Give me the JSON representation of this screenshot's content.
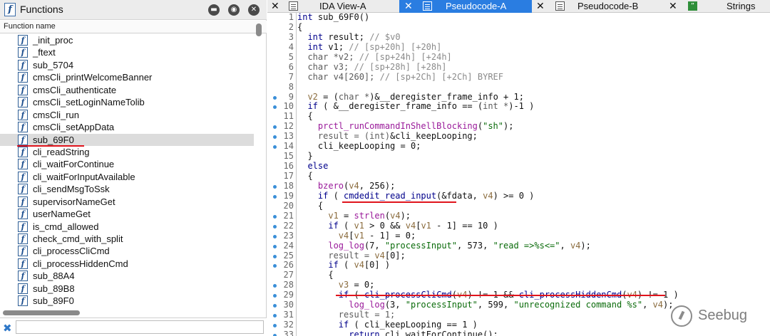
{
  "functions_panel": {
    "title": "Functions",
    "column_header": "Function name",
    "items": [
      "_init_proc",
      "_ftext",
      "sub_5704",
      "cmsCli_printWelcomeBanner",
      "cmsCli_authenticate",
      "cmsCli_setLoginNameTolib",
      "cmsCli_run",
      "cmsCli_setAppData",
      "sub_69F0",
      "cli_readString",
      "cli_waitForContinue",
      "cli_waitForInputAvailable",
      "cli_sendMsgToSsk",
      "supervisorNameGet",
      "userNameGet",
      "is_cmd_allowed",
      "check_cmd_with_split",
      "cli_processCliCmd",
      "cli_processHiddenCmd",
      "sub_88A4",
      "sub_89B8",
      "sub_89F0"
    ],
    "selected_item": "sub_69F0",
    "filter_value": "",
    "function_icon_glyph": "f"
  },
  "tabs": [
    {
      "label": "IDA View-A",
      "icon": "text-view-icon",
      "active": false
    },
    {
      "label": "Pseudocode-A",
      "icon": "text-view-icon",
      "active": true
    },
    {
      "label": "Pseudocode-B",
      "icon": "text-view-icon",
      "active": false
    },
    {
      "label": "Strings",
      "icon": "strings-icon",
      "active": false
    }
  ],
  "code_lines": [
    {
      "num": "1",
      "dot": false,
      "html": "<span class='k'>int</span> <span class='p'>sub_69F0()</span>"
    },
    {
      "num": "2",
      "dot": false,
      "html": "<span class='p'>{</span>"
    },
    {
      "num": "3",
      "dot": false,
      "html": "  <span class='k'>int</span> <span class='p'>result</span><span class='p'>;</span> <span class='c'>// $v0</span>"
    },
    {
      "num": "4",
      "dot": false,
      "html": "  <span class='k'>int</span> <span class='p'>v1</span><span class='p'>;</span> <span class='c'>// [sp+20h] [+20h]</span>"
    },
    {
      "num": "5",
      "dot": false,
      "html": "  <span class='n'>char *v2;</span> <span class='c'>// [sp+24h] [+24h]</span>"
    },
    {
      "num": "6",
      "dot": false,
      "html": "  <span class='n'>char v3;</span> <span class='c'>// [sp+28h] [+28h]</span>"
    },
    {
      "num": "7",
      "dot": false,
      "html": "  <span class='n'>char v4[260];</span> <span class='c'>// [sp+2Ch] [+2Ch] BYREF</span>"
    },
    {
      "num": "8",
      "dot": false,
      "html": ""
    },
    {
      "num": "9",
      "dot": true,
      "html": "  <span class='v'>v2</span> <span class='p'>= (</span><span class='n'>char *</span><span class='p'>)&amp;__deregister_frame_info + 1;</span>"
    },
    {
      "num": "10",
      "dot": true,
      "html": "  <span class='k'>if</span> <span class='p'>( &amp;__deregister_frame_info == (</span><span class='n'>int *</span><span class='p'>)-1 )</span>"
    },
    {
      "num": "11",
      "dot": false,
      "html": "  <span class='p'>{</span>"
    },
    {
      "num": "12",
      "dot": true,
      "html": "    <span class='f'>prctl_runCommandInShellBlocking</span><span class='p'>(</span><span class='s'>\"sh\"</span><span class='p'>);</span>"
    },
    {
      "num": "13",
      "dot": true,
      "html": "    <span class='n'>result = (int)</span><span class='p'>&amp;cli_keepLooping;</span>"
    },
    {
      "num": "14",
      "dot": true,
      "html": "    <span class='p'>cli_keepLooping = 0;</span>"
    },
    {
      "num": "15",
      "dot": false,
      "html": "  <span class='p'>}</span>"
    },
    {
      "num": "16",
      "dot": false,
      "html": "  <span class='k'>else</span>"
    },
    {
      "num": "17",
      "dot": false,
      "html": "  <span class='p'>{</span>"
    },
    {
      "num": "18",
      "dot": true,
      "html": "    <span class='f'>bzero</span><span class='p'>(</span><span class='v'>v4</span><span class='p'>, 256);</span>"
    },
    {
      "num": "19",
      "dot": true,
      "html": "    <span class='k'>if</span> <span class='p'>( </span><span class='k'>cmdedit_read_input</span><span class='p'>(&amp;fdata, </span><span class='v'>v4</span><span class='p'>) &gt;= 0 )</span>"
    },
    {
      "num": "20",
      "dot": false,
      "html": "    <span class='p'>{</span>"
    },
    {
      "num": "21",
      "dot": true,
      "html": "      <span class='v'>v1</span> <span class='p'>=</span> <span class='f'>strlen</span><span class='p'>(</span><span class='v'>v4</span><span class='p'>);</span>"
    },
    {
      "num": "22",
      "dot": true,
      "html": "      <span class='k'>if</span> <span class='p'>( </span><span class='v'>v1</span><span class='p'> &gt; 0 &amp;&amp; </span><span class='v'>v4</span><span class='p'>[</span><span class='v'>v1</span><span class='p'> - 1] == 10 )</span>"
    },
    {
      "num": "23",
      "dot": true,
      "html": "        <span class='v'>v4</span><span class='p'>[</span><span class='v'>v1</span><span class='p'> - 1] = 0;</span>"
    },
    {
      "num": "24",
      "dot": true,
      "html": "      <span class='f'>log_log</span><span class='p'>(7, </span><span class='s'>\"processInput\"</span><span class='p'>, 573, </span><span class='s'>\"read =&gt;%s&lt;=\"</span><span class='p'>, </span><span class='v'>v4</span><span class='p'>);</span>"
    },
    {
      "num": "25",
      "dot": true,
      "html": "      <span class='n'>result = </span><span class='v'>v4</span><span class='p'>[0];</span>"
    },
    {
      "num": "26",
      "dot": true,
      "html": "      <span class='k'>if</span> <span class='p'>( </span><span class='v'>v4</span><span class='p'>[0] )</span>"
    },
    {
      "num": "27",
      "dot": false,
      "html": "      <span class='p'>{</span>"
    },
    {
      "num": "28",
      "dot": true,
      "html": "        <span class='v'>v3</span> <span class='p'>= 0;</span>"
    },
    {
      "num": "29",
      "dot": true,
      "html": "        <span class='k'>if</span> <span class='p'>( </span><span class='k'>cli_processCliCmd</span><span class='p'>(</span><span class='v'>v4</span><span class='p'>) != 1 &amp;&amp; </span><span class='k'>cli_processHiddenCmd</span><span class='p'>(</span><span class='v'>v4</span><span class='p'>) != 1 )</span>"
    },
    {
      "num": "30",
      "dot": true,
      "html": "          <span class='f'>log_log</span><span class='p'>(3, </span><span class='s'>\"processInput\"</span><span class='p'>, 599, </span><span class='s'>\"unrecognized command %s\"</span><span class='p'>, </span><span class='v'>v4</span><span class='p'>);</span>"
    },
    {
      "num": "31",
      "dot": true,
      "html": "        <span class='n'>result = 1;</span>"
    },
    {
      "num": "32",
      "dot": true,
      "html": "        <span class='k'>if</span> <span class='p'>( cli_keepLooping == 1 )</span>"
    },
    {
      "num": "33",
      "dot": true,
      "html": "          <span class='k'>return</span> <span class='p'>cli_waitForContinue();</span>"
    }
  ],
  "watermark": {
    "text": "Seebug"
  },
  "colors": {
    "tab_active": "#2a7de1",
    "annotation_underline": "#e0141c",
    "breakpoint_dot": "#3a8fd8"
  }
}
